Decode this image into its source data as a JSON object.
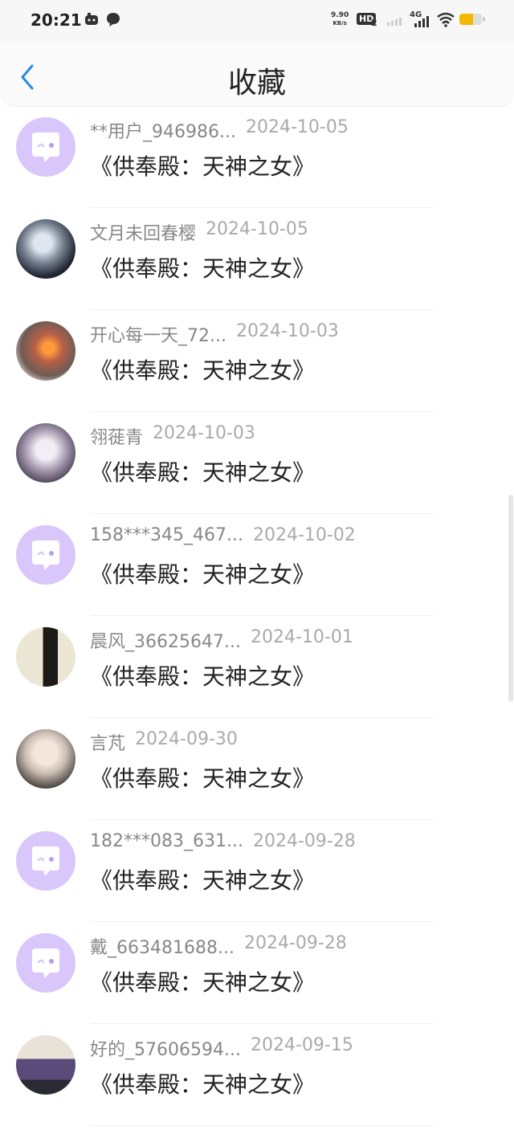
{
  "status_bar": {
    "time": "20:21",
    "net_speed_value": "9.90",
    "net_speed_unit": "KB/s",
    "hd_label": "HD",
    "hd_sub": "2",
    "network": "4G",
    "battery_level": 0.6,
    "battery_color": "#f5b800"
  },
  "header": {
    "title": "收藏",
    "back_icon": "chevron-left-icon",
    "accent_color": "#2a8cdc"
  },
  "favorites": [
    {
      "username": "**用户_946986...",
      "date": "2024-10-05",
      "book": "《供奉殿：天神之女》",
      "avatar": "default-chat-avatar"
    },
    {
      "username": "文月未回春樱",
      "date": "2024-10-05",
      "book": "《供奉殿：天神之女》",
      "avatar": "photo-avatar-dark-anime"
    },
    {
      "username": "开心每一天_72...",
      "date": "2024-10-03",
      "book": "《供奉殿：天神之女》",
      "avatar": "photo-avatar-orange-glow"
    },
    {
      "username": "翎蓰青",
      "date": "2024-10-03",
      "book": "《供奉殿：天神之女》",
      "avatar": "photo-avatar-pale-girl"
    },
    {
      "username": "158***345_467...",
      "date": "2024-10-02",
      "book": "《供奉殿：天神之女》",
      "avatar": "default-chat-avatar"
    },
    {
      "username": "晨风_36625647...",
      "date": "2024-10-01",
      "book": "《供奉殿：天神之女》",
      "avatar": "photo-avatar-calligraphy"
    },
    {
      "username": "言芃",
      "date": "2024-09-30",
      "book": "《供奉殿：天神之女》",
      "avatar": "photo-avatar-girl-hoodie"
    },
    {
      "username": "182***083_631...",
      "date": "2024-09-28",
      "book": "《供奉殿：天神之女》",
      "avatar": "default-chat-avatar"
    },
    {
      "username": "戴_663481688...",
      "date": "2024-09-28",
      "book": "《供奉殿：天神之女》",
      "avatar": "default-chat-avatar"
    },
    {
      "username": "好的_57606594...",
      "date": "2024-09-15",
      "book": "《供奉殿：天神之女》",
      "avatar": "photo-avatar-purple-text"
    }
  ],
  "avatar_default_color": "#d9c6fb"
}
